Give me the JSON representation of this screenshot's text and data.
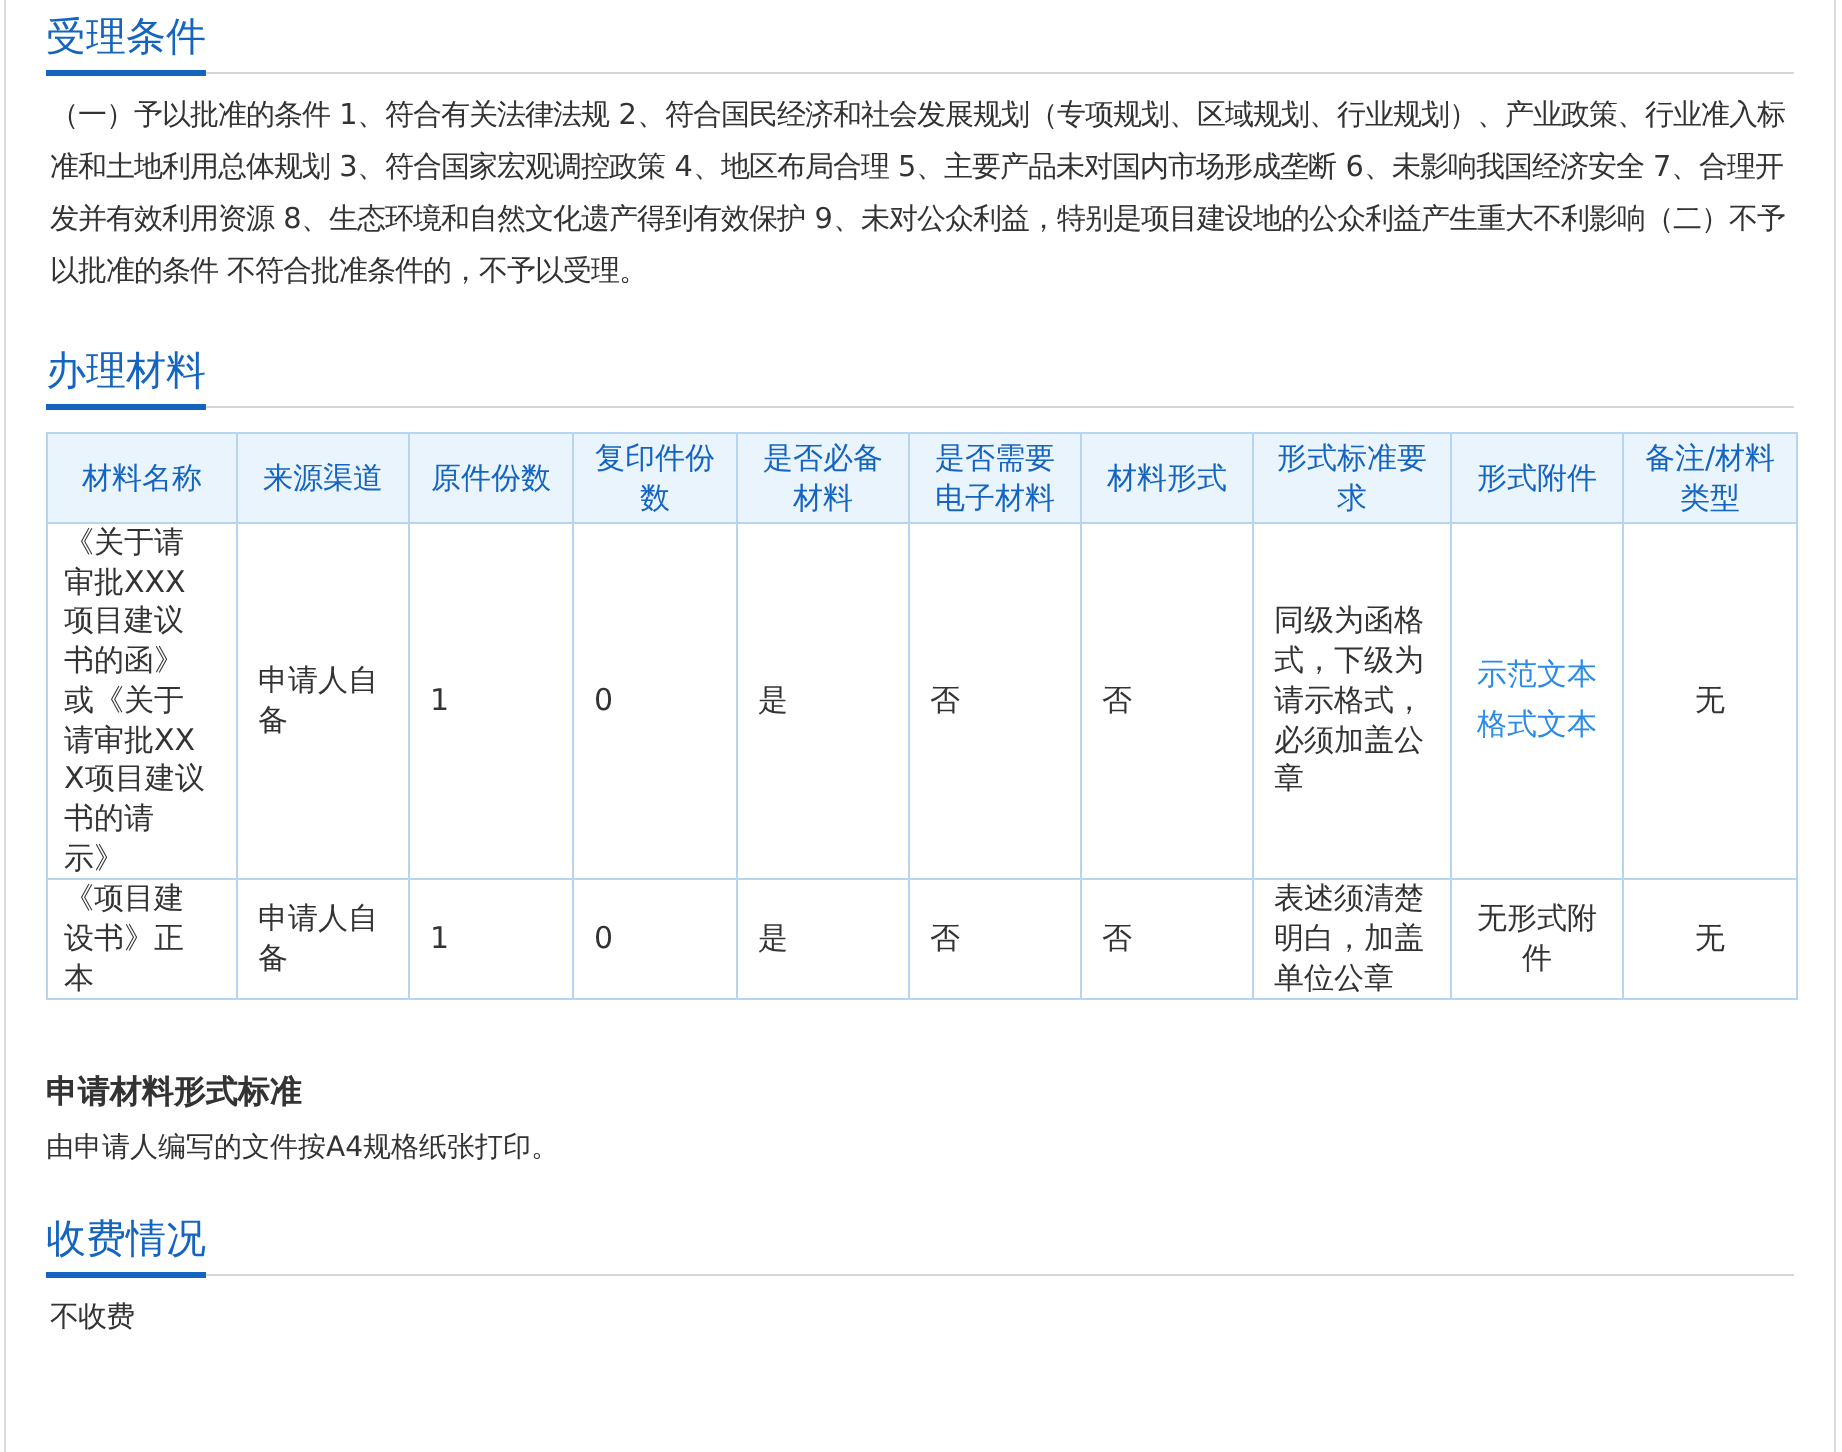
{
  "sections": [
    {
      "kind": "text",
      "title": "受理条件",
      "paragraphs": [
        "（一）予以批准的条件 1、符合有关法律法规 2、符合国民经济和社会发展规划（专项规划、区域规划、行业规划）、产业政策、行业准入标准和土地利用总体规划 3、符合国家宏观调控政策 4、地区布局合理 5、主要产品未对国内市场形成垄断 6、未影响我国经济安全 7、合理开发并有效利用资源 8、生态环境和自然文化遗产得到有效保护 9、未对公众利益，特别是项目建设地的公众利益产生重大不利影响（二）不予以批准的条件 不符合批准条件的，不予以受理。"
      ]
    },
    {
      "kind": "table",
      "title": "办理材料",
      "table": {
        "columns": [
          "材料名称",
          "来源渠道",
          "原件份数",
          "复印件份数",
          "是否必备材料",
          "是否需要电子材料",
          "材料形式",
          "形式标准要求",
          "形式附件",
          "备注/材料类型"
        ],
        "rows": [
          {
            "cells": [
              "《关于请审批XXX项目建议书的函》或《关于请审批XXX项目建议书的请示》",
              "申请人自备",
              "1",
              "0",
              "是",
              "否",
              "否",
              "同级为函格式，下级为请示格式，必须加盖公章",
              {
                "links": [
                  "示范文本",
                  "格式文本"
                ]
              },
              "无"
            ]
          },
          {
            "cells": [
              "《项目建设书》正本",
              "申请人自备",
              "1",
              "0",
              "是",
              "否",
              "否",
              "表述须清楚明白，加盖单位公章",
              "无形式附件",
              "无"
            ]
          }
        ]
      },
      "subsections": [
        {
          "heading": "申请材料形式标准",
          "text": "由申请人编写的文件按A4规格纸张打印。"
        }
      ]
    },
    {
      "kind": "text",
      "title": "收费情况",
      "paragraphs": [
        "不收费"
      ]
    }
  ]
}
